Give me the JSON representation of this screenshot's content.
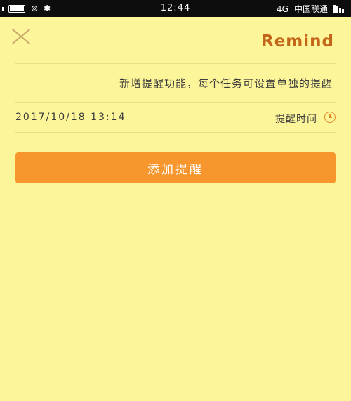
{
  "status_bar": {
    "time": "12:44",
    "network_type": "4G",
    "carrier": "中国联通"
  },
  "header": {
    "title": "Remind"
  },
  "description": "新增提醒功能，每个任务可设置单独的提醒",
  "reminder": {
    "label": "提醒时间",
    "datetime": "2017/10/18 13:14"
  },
  "add_button": {
    "label": "添加提醒"
  },
  "colors": {
    "background": "#fdf59a",
    "accent": "#f6962d",
    "title": "#c4661a"
  }
}
